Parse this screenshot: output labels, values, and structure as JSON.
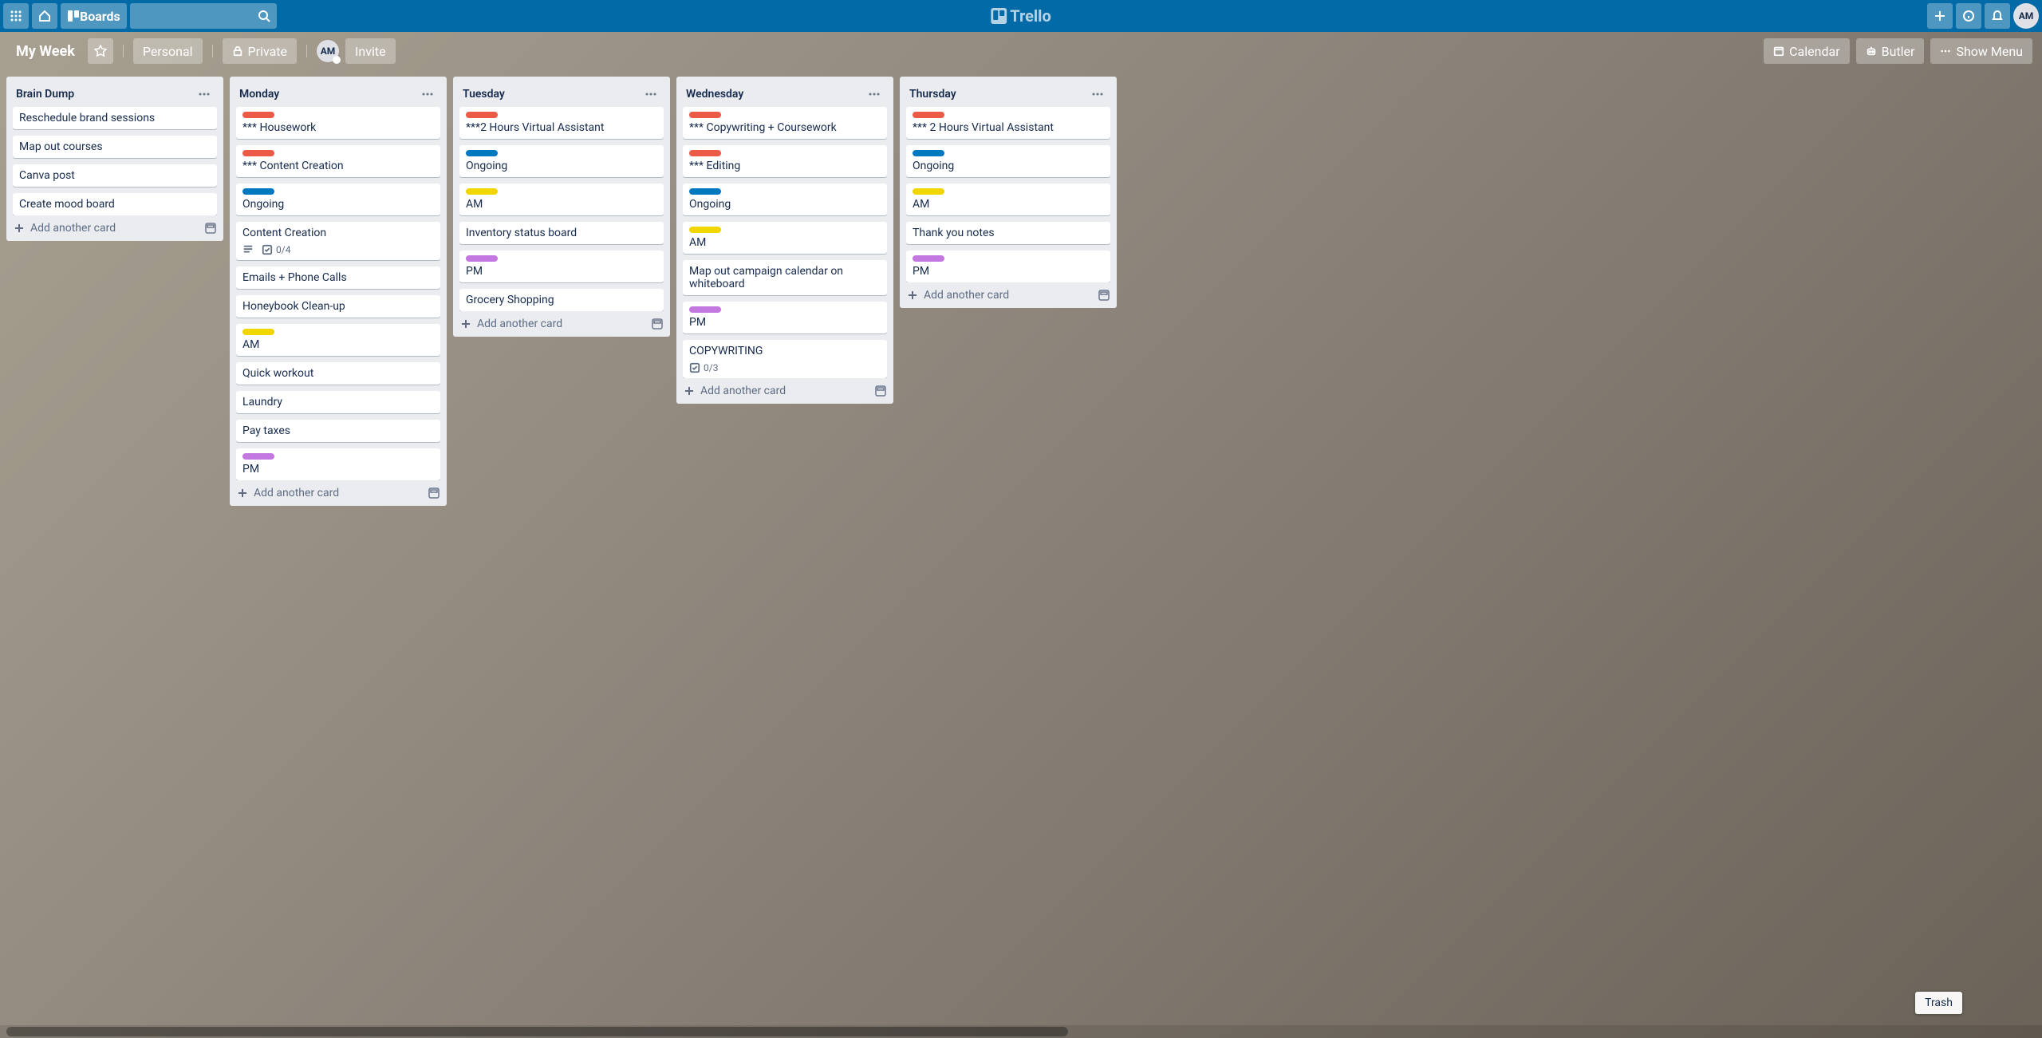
{
  "header": {
    "boards": "Boards",
    "logo": "Trello",
    "avatar_initials": "AM"
  },
  "board_header": {
    "title": "My Week",
    "personal": "Personal",
    "private": "Private",
    "avatar_initials": "AM",
    "invite": "Invite",
    "calendar": "Calendar",
    "butler": "Butler",
    "show_menu": "Show Menu"
  },
  "add_card_label": "Add another card",
  "lists": [
    {
      "title": "Brain Dump",
      "cards": [
        {
          "title": "Reschedule brand sessions"
        },
        {
          "title": "Map out courses"
        },
        {
          "title": "Canva post"
        },
        {
          "title": "Create mood board"
        }
      ]
    },
    {
      "title": "Monday",
      "cards": [
        {
          "labels": [
            "red"
          ],
          "title": "*** Housework"
        },
        {
          "labels": [
            "red"
          ],
          "title": "*** Content Creation"
        },
        {
          "labels": [
            "blue"
          ],
          "title": "Ongoing"
        },
        {
          "title": "Content Creation",
          "desc": true,
          "checklist": "0/4"
        },
        {
          "title": "Emails + Phone Calls"
        },
        {
          "title": "Honeybook Clean-up"
        },
        {
          "labels": [
            "yellow"
          ],
          "title": "AM"
        },
        {
          "title": "Quick workout"
        },
        {
          "title": "Laundry"
        },
        {
          "title": "Pay taxes"
        },
        {
          "labels": [
            "purple"
          ],
          "title": "PM"
        }
      ]
    },
    {
      "title": "Tuesday",
      "cards": [
        {
          "labels": [
            "red"
          ],
          "title": "***2 Hours Virtual Assistant"
        },
        {
          "labels": [
            "blue"
          ],
          "title": "Ongoing"
        },
        {
          "labels": [
            "yellow"
          ],
          "title": "AM"
        },
        {
          "title": "Inventory status board"
        },
        {
          "labels": [
            "purple"
          ],
          "title": "PM"
        },
        {
          "title": "Grocery Shopping"
        }
      ]
    },
    {
      "title": "Wednesday",
      "cards": [
        {
          "labels": [
            "red"
          ],
          "title": "*** Copywriting + Coursework"
        },
        {
          "labels": [
            "red"
          ],
          "title": "*** Editing"
        },
        {
          "labels": [
            "blue"
          ],
          "title": "Ongoing"
        },
        {
          "labels": [
            "yellow"
          ],
          "title": "AM"
        },
        {
          "title": "Map out campaign calendar on whiteboard"
        },
        {
          "labels": [
            "purple"
          ],
          "title": "PM"
        },
        {
          "title": "COPYWRITING",
          "checklist": "0/3"
        }
      ]
    },
    {
      "title": "Thursday",
      "cards": [
        {
          "labels": [
            "red"
          ],
          "title": "*** 2 Hours Virtual Assistant"
        },
        {
          "labels": [
            "blue"
          ],
          "title": "Ongoing"
        },
        {
          "labels": [
            "yellow"
          ],
          "title": "AM"
        },
        {
          "title": "Thank you notes"
        },
        {
          "labels": [
            "purple"
          ],
          "title": "PM"
        }
      ]
    }
  ],
  "trash": "Trash"
}
